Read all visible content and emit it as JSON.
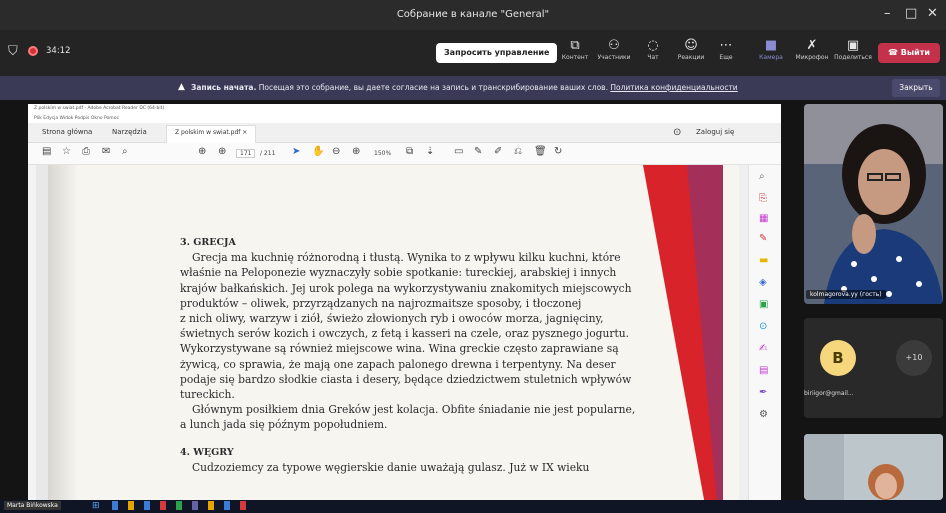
{
  "window": {
    "title": "Собрание в канале \"General\"",
    "controls": [
      "–",
      "□",
      "✕"
    ]
  },
  "meeting": {
    "timer": "34:12",
    "request_control": "Запросить управление",
    "toolbar": [
      {
        "icon": "content-icon",
        "label": "Контент"
      },
      {
        "icon": "participants-icon",
        "label": "Участники"
      },
      {
        "icon": "chat-icon",
        "label": "Чат"
      },
      {
        "icon": "reactions-icon",
        "label": "Реакции"
      },
      {
        "icon": "more-icon",
        "label": "Еще"
      },
      {
        "icon": "camera-icon",
        "label": "Камера"
      },
      {
        "icon": "mic-icon",
        "label": "Микрофон"
      },
      {
        "icon": "share-icon",
        "label": "Поделиться"
      }
    ],
    "leave": "Выйти",
    "recording": {
      "bold": "Запись начата.",
      "text": "Посещая это собрание, вы даете согласие на запись и транскрибирование ваших слов.",
      "link": "Политика конфиденциальности",
      "close": "Закрыть"
    }
  },
  "acrobat": {
    "title": "Z polskim w swiat.pdf - Adobe Acrobat Reader DC (64-bit)",
    "menu": "Plik  Edycja  Widok  Podpis  Okno  Pomoc",
    "tabs": [
      "Strona główna",
      "Narzędzia",
      "Z polskim w swiat.pdf"
    ],
    "signin": "Zaloguj się",
    "page_current": "171",
    "page_total": "/ 211",
    "zoom": "150%",
    "pdf_text": {
      "h1": "3. GRECJA",
      "lines": [
        "Grecja ma kuchnię różnorodną i tłustą. Wynika to z wpływu kilku kuchni, które",
        "właśnie na Peloponezie wyznaczyły sobie spotkanie: tureckiej, arabskiej i innych",
        "krajów bałkańskich. Jej urok polega na wykorzystywaniu znakomitych miejscowych",
        "produktów – oliwek, przyrządzanych na najrozmaitsze sposoby, i tłoczonej",
        "z nich oliwy, warzyw i ziół, świeżo złowionych ryb i owoców morza, jagnięciny,",
        "świetnych serów kozich i owczych, z fetą i kasseri na czele, oraz pysznego jogurtu.",
        "Wykorzystywane są również miejscowe wina. Wina greckie często zaprawiane są",
        "żywicą, co sprawia, że mają one zapach palonego drewna i terpentyny. Na deser",
        "podaje się bardzo słodkie ciasta i desery, będące dziedzictwem stuletnich wpływów",
        "tureckich.",
        "Głównym posiłkiem dnia Greków jest kolacja. Obfite śniadanie nie jest popularne,",
        "a lunch jada się późnym popołudniem."
      ],
      "h2": "4. WĘGRY",
      "last": "Cudzoziemcy za typowe węgierskie danie uważają gulasz. Już w IX wieku"
    }
  },
  "participants": {
    "video1_name": "kolmagorova.yy (гость)",
    "avatar_letter": "B",
    "avatar_name": "biriigor@gmail...",
    "more_count": "+10",
    "presenter_name": "Marta Bińkowska"
  },
  "colors": {
    "leave": "#c4314b",
    "accent": "#6264a7",
    "band": "#3a3a57"
  }
}
